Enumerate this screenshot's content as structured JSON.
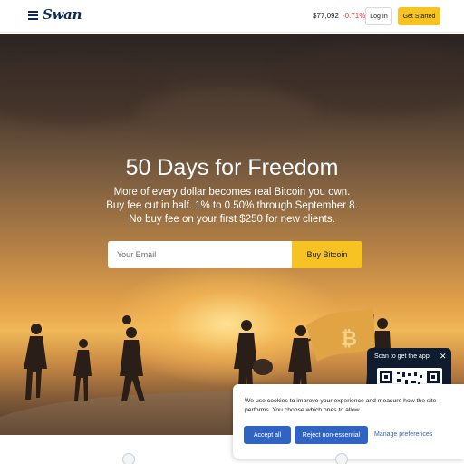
{
  "header": {
    "logo": "Swan",
    "btc_price": "$77,092",
    "btc_change": "-0.71%",
    "login_label": "Log In",
    "get_started_label": "Get Started"
  },
  "hero": {
    "title": "50 Days for Freedom",
    "subtitle_lines": [
      "More of every dollar becomes real Bitcoin you own.",
      "Buy fee cut in half. 1% to 0.50% through September 8.",
      "No buy fee on your first $250 for new clients."
    ],
    "email_placeholder": "Your Email",
    "buy_label": "Buy Bitcoin"
  },
  "scan_widget": {
    "label": "Scan to get the app",
    "close_icon": "close-icon"
  },
  "cookie_banner": {
    "text": "We use cookies to improve your experience and measure how the site performs. You choose which ones to allow.",
    "accept_label": "Accept all",
    "reject_label": "Reject non-essential",
    "manage_label": "Manage preferences"
  },
  "colors": {
    "brand_navy": "#0b2a57",
    "accent_yellow": "#f7c322",
    "negative_red": "#e23b3b",
    "cookie_blue": "#2f63c4"
  }
}
